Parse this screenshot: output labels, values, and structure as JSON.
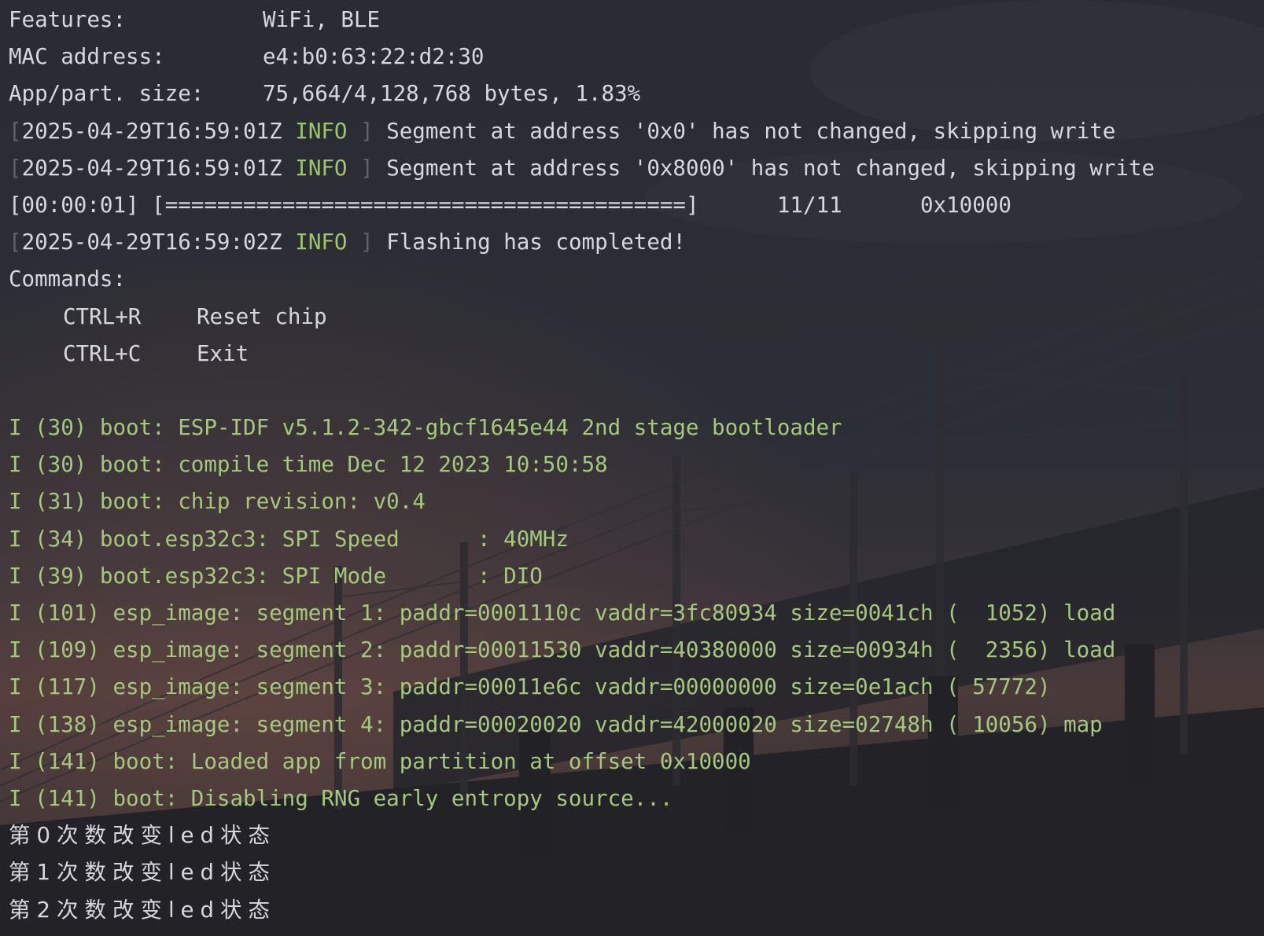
{
  "header_info": [
    {
      "label": "Features:",
      "value": "WiFi, BLE"
    },
    {
      "label": "MAC address:",
      "value": "e4:b0:63:22:d2:30"
    },
    {
      "label": "App/part. size:",
      "value": "75,664/4,128,768 bytes, 1.83%"
    }
  ],
  "log_info": [
    {
      "timestamp": "2025-04-29T16:59:01Z",
      "level": "INFO",
      "message": "Segment at address '0x0' has not changed, skipping write"
    },
    {
      "timestamp": "2025-04-29T16:59:01Z",
      "level": "INFO",
      "message": "Segment at address '0x8000' has not changed, skipping write"
    }
  ],
  "progress": {
    "elapsed": "[00:00:01]",
    "bar": "[========================================]",
    "count": "11/11",
    "address": "0x10000",
    "fraction": 1.0
  },
  "log_complete": {
    "timestamp": "2025-04-29T16:59:02Z",
    "level": "INFO",
    "message": "Flashing has completed!"
  },
  "commands": {
    "title": "Commands:",
    "items": [
      {
        "key": "CTRL+R",
        "action": "Reset chip"
      },
      {
        "key": "CTRL+C",
        "action": "Exit"
      }
    ]
  },
  "boot_lines": [
    "I (30) boot: ESP-IDF v5.1.2-342-gbcf1645e44 2nd stage bootloader",
    "I (30) boot: compile time Dec 12 2023 10:50:58",
    "I (31) boot: chip revision: v0.4",
    "I (34) boot.esp32c3: SPI Speed      : 40MHz",
    "I (39) boot.esp32c3: SPI Mode       : DIO",
    "I (101) esp_image: segment 1: paddr=0001110c vaddr=3fc80934 size=0041ch (  1052) load",
    "I (109) esp_image: segment 2: paddr=00011530 vaddr=40380000 size=00934h (  2356) load",
    "I (117) esp_image: segment 3: paddr=00011e6c vaddr=00000000 size=0e1ach ( 57772)",
    "I (138) esp_image: segment 4: paddr=00020020 vaddr=42000020 size=02748h ( 10056) map",
    "I (141) boot: Loaded app from partition at offset 0x10000",
    "I (141) boot: Disabling RNG early entropy source..."
  ],
  "app_output": [
    "第0次数改变led状态",
    "第1次数改变led状态",
    "第2次数改变led状态"
  ],
  "colors": {
    "plain_text": "#d6d8de",
    "boot_text": "#a6c77e",
    "info_level": "#9fc46f",
    "bracket": "#5f6269"
  }
}
